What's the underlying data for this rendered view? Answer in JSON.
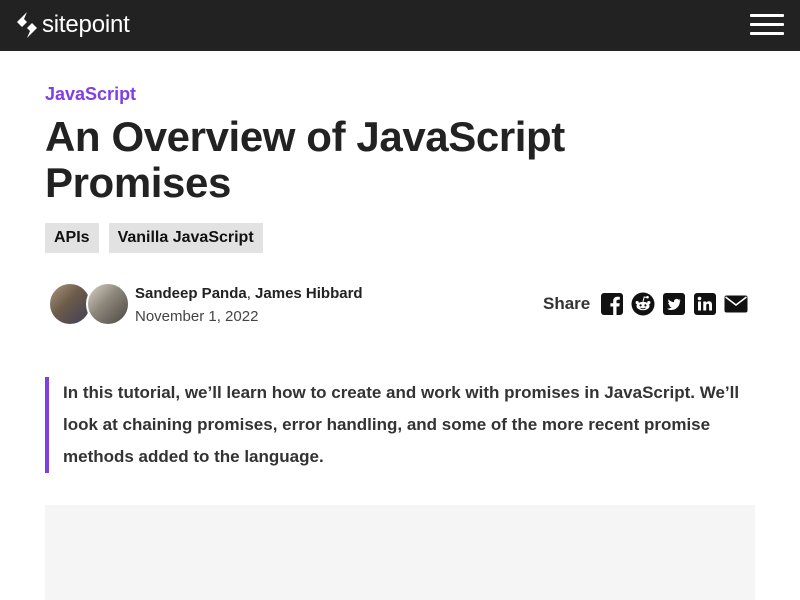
{
  "header": {
    "logo_text": "sitepoint",
    "logo_icon": "sitepoint-logo-icon",
    "menu_icon": "hamburger-menu-icon",
    "background": "#222222"
  },
  "article": {
    "category": "JavaScript",
    "category_color": "#7f3fe4",
    "title": "An Overview of JavaScript Promises",
    "tags": [
      "APIs",
      "Vanilla JavaScript"
    ],
    "authors": [
      "Sandeep Panda",
      "James Hibbard"
    ],
    "author_separator": ",",
    "date": "November 1, 2022",
    "intro": "In this tutorial, we’ll learn how to create and work with promises in JavaScript. We’ll look at chaining promises, error handling, and some of the more recent promise methods added to the language."
  },
  "share": {
    "label": "Share",
    "icons": [
      "facebook-icon",
      "reddit-icon",
      "twitter-icon",
      "linkedin-icon",
      "email-icon"
    ]
  }
}
